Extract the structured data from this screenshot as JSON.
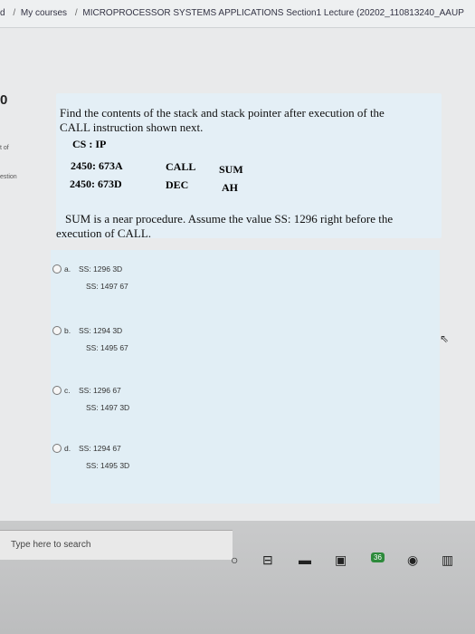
{
  "breadcrumb": {
    "items": [
      "d",
      "My courses",
      "MICROPROCESSOR SYSTEMS APPLICATIONS Section1 Lecture (20202_110813240_AAUP"
    ]
  },
  "sidebar": {
    "question_number": "0",
    "text1": "t of",
    "text2": "estion"
  },
  "question": {
    "line1": "Find the contents of the stack and stack pointer after execution of the",
    "line2": "CALL instruction shown next.",
    "header": "CS  :  IP",
    "row1_addr": "2450: 673A",
    "row1_op": "CALL",
    "row1_arg": "SUM",
    "row2_addr": "2450: 673D",
    "row2_op": "DEC",
    "row2_arg": "AH",
    "note1": "SUM is a near procedure. Assume the value SS: 1296 right before the",
    "note2": "execution of CALL."
  },
  "options": [
    {
      "label": "a.",
      "line1": "SS: 1296 3D",
      "line2": "SS: 1497 67"
    },
    {
      "label": "b.",
      "line1": "SS: 1294 3D",
      "line2": "SS: 1495 67"
    },
    {
      "label": "c.",
      "line1": "SS: 1296 67",
      "line2": "SS: 1497 3D"
    },
    {
      "label": "d.",
      "line1": "SS: 1294 67",
      "line2": "SS: 1495 3D"
    }
  ],
  "taskbar": {
    "search_placeholder": "Type here to search",
    "badge": "36"
  }
}
